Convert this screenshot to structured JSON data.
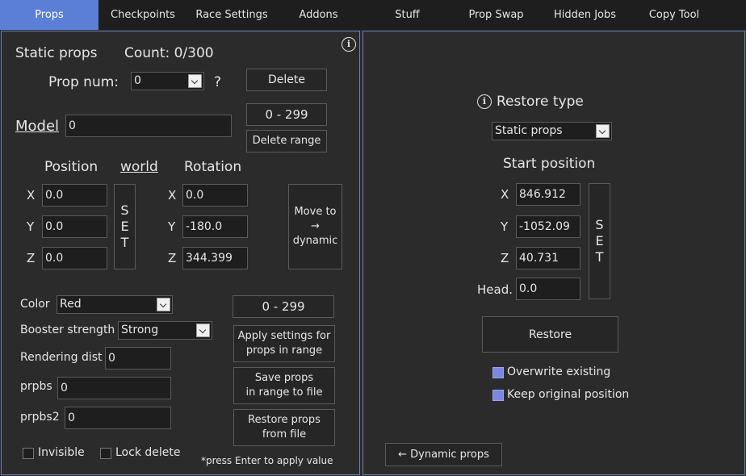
{
  "tabs": [
    {
      "label": "Props",
      "active": true
    },
    {
      "label": "Checkpoints"
    },
    {
      "label": "Race Settings"
    },
    {
      "label": "Addons"
    },
    {
      "label": "Stuff"
    },
    {
      "label": "Prop Swap"
    },
    {
      "label": "Hidden Jobs"
    },
    {
      "label": "Copy Tool"
    }
  ],
  "left": {
    "title": "Static props",
    "count": "Count: 0/300",
    "prop_num_label": "Prop num:",
    "prop_num_value": "0",
    "help": "?",
    "delete": "Delete",
    "range_top": "0 - 299",
    "model_label": "Model",
    "model_value": "0",
    "delete_range": "Delete range",
    "position_label": "Position",
    "world_label": "world",
    "rotation_label": "Rotation",
    "pos": {
      "x_label": "X",
      "x": "0.0",
      "y_label": "Y",
      "y": "0.0",
      "z_label": "Z",
      "z": "0.0"
    },
    "rot": {
      "x_label": "X",
      "x": "0.0",
      "y_label": "Y",
      "y": "-180.0",
      "z_label": "Z",
      "z": "344.399"
    },
    "set": [
      "S",
      "E",
      "T"
    ],
    "move_to": "Move to",
    "move_arrow": "→",
    "move_dynamic": "dynamic",
    "color_label": "Color",
    "color_value": "Red",
    "booster_label": "Booster strength",
    "booster_value": "Strong",
    "render_label": "Rendering dist",
    "render_value": "0",
    "prpbs_label": "prpbs",
    "prpbs_value": "0",
    "prpbs2_label": "prpbs2",
    "prpbs2_value": "0",
    "range_mid": "0 - 299",
    "apply_1": "Apply settings for",
    "apply_2": "props in range",
    "save_1": "Save props",
    "save_2": "in range to file",
    "restore_1": "Restore props",
    "restore_2": "from file",
    "invisible": "Invisible",
    "lock_delete": "Lock delete",
    "note": "*press Enter to apply value"
  },
  "right": {
    "restore_type_label": "Restore type",
    "restore_type_value": "Static props",
    "start_position": "Start position",
    "x_label": "X",
    "x": "846.912",
    "y_label": "Y",
    "y": "-1052.09",
    "z_label": "Z",
    "z": "40.731",
    "head_label": "Head.",
    "head": "0.0",
    "set": [
      "S",
      "E",
      "T"
    ],
    "restore": "Restore",
    "overwrite": "Overwrite existing",
    "keep_original": "Keep original position",
    "dynamic_props": "← Dynamic props"
  },
  "colors": {
    "accent": "#5b7fd6",
    "border": "#6d7fb8",
    "checked": "#7a88e0"
  }
}
